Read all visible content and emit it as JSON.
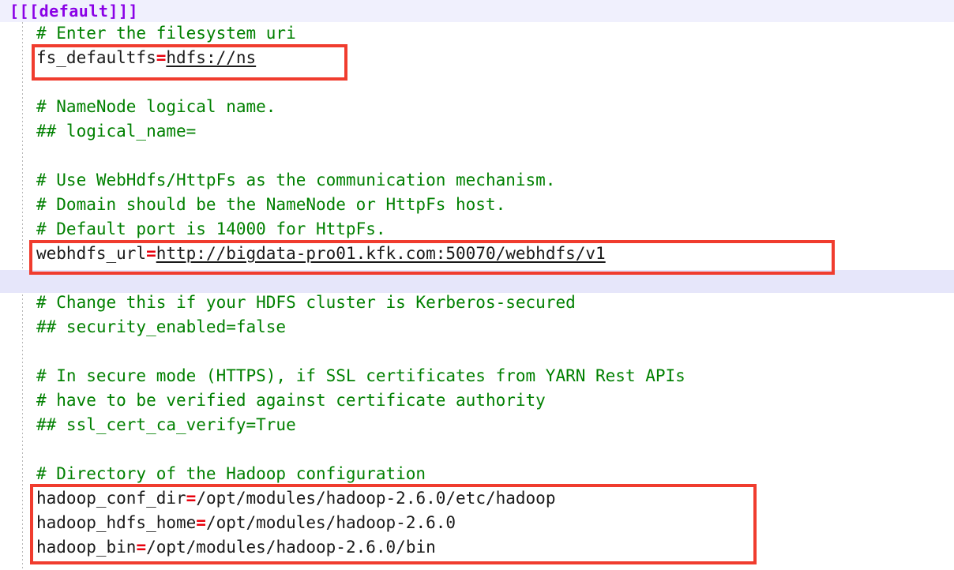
{
  "editor": {
    "section_header": "[[[default]]]",
    "colors": {
      "header_text": "#8a00e6",
      "header_band": "#f0f0fd",
      "comment": "#008000",
      "equals": "#e8000d",
      "annotation_box": "#f03c2e",
      "highlight_line": "#e6e6fa",
      "background": "#ffffff",
      "text": "#1a1a1a"
    },
    "lines": [
      {
        "id": "l1",
        "type": "comment",
        "text": "# Enter the filesystem uri"
      },
      {
        "id": "l2",
        "type": "setting",
        "key": "fs_defaultfs",
        "eq": "=",
        "value": "hdfs://ns",
        "underline": true
      },
      {
        "id": "l3",
        "type": "blank",
        "text": ""
      },
      {
        "id": "l4",
        "type": "comment",
        "text": "# NameNode logical name."
      },
      {
        "id": "l5",
        "type": "comment",
        "text": "## logical_name="
      },
      {
        "id": "l6",
        "type": "blank",
        "text": ""
      },
      {
        "id": "l7",
        "type": "comment",
        "text": "# Use WebHdfs/HttpFs as the communication mechanism."
      },
      {
        "id": "l8",
        "type": "comment",
        "text": "# Domain should be the NameNode or HttpFs host."
      },
      {
        "id": "l9",
        "type": "comment",
        "text": "# Default port is 14000 for HttpFs."
      },
      {
        "id": "l10",
        "type": "setting",
        "key": "webhdfs_url",
        "eq": "=",
        "value": "http://bigdata-pro01.kfk.com:50070/webhdfs/v1",
        "underline": true
      },
      {
        "id": "l11",
        "type": "blank",
        "text": ""
      },
      {
        "id": "l12",
        "type": "comment",
        "text": "# Change this if your HDFS cluster is Kerberos-secured"
      },
      {
        "id": "l13",
        "type": "comment",
        "text": "## security_enabled=false"
      },
      {
        "id": "l14",
        "type": "blank",
        "text": ""
      },
      {
        "id": "l15",
        "type": "comment",
        "text": "# In secure mode (HTTPS), if SSL certificates from YARN Rest APIs"
      },
      {
        "id": "l16",
        "type": "comment",
        "text": "# have to be verified against certificate authority"
      },
      {
        "id": "l17",
        "type": "comment",
        "text": "## ssl_cert_ca_verify=True"
      },
      {
        "id": "l18",
        "type": "blank",
        "text": ""
      },
      {
        "id": "l19",
        "type": "comment",
        "text": "# Directory of the Hadoop configuration"
      },
      {
        "id": "l20",
        "type": "setting",
        "key": "hadoop_conf_dir",
        "eq": "=",
        "value": "/opt/modules/hadoop-2.6.0/etc/hadoop",
        "underline": false
      },
      {
        "id": "l21",
        "type": "setting",
        "key": "hadoop_hdfs_home",
        "eq": "=",
        "value": "/opt/modules/hadoop-2.6.0",
        "underline": false
      },
      {
        "id": "l22",
        "type": "setting",
        "key": "hadoop_bin",
        "eq": "=",
        "value": "/opt/modules/hadoop-2.6.0/bin",
        "underline": false
      }
    ],
    "annotations": [
      {
        "id": "a1",
        "label": "fs-defaultfs-highlight"
      },
      {
        "id": "a2",
        "label": "webhdfs-url-highlight"
      },
      {
        "id": "a3",
        "label": "hadoop-paths-highlight"
      }
    ]
  }
}
